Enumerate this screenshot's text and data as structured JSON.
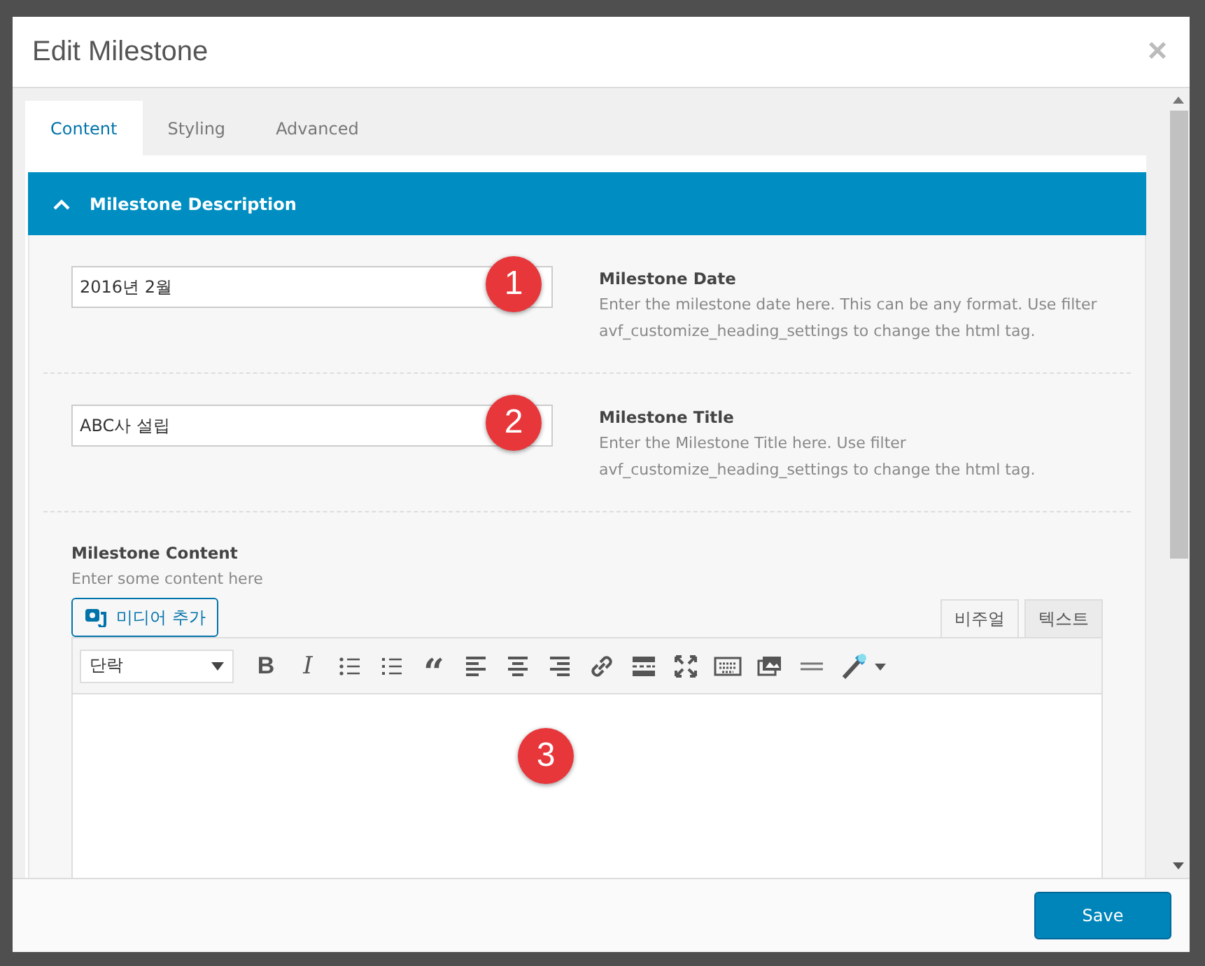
{
  "dialog": {
    "title": "Edit Milestone",
    "close": "×"
  },
  "tabs": [
    {
      "label": "Content",
      "selected": true
    },
    {
      "label": "Styling",
      "selected": false
    },
    {
      "label": "Advanced",
      "selected": false
    }
  ],
  "section": {
    "title": "Milestone Description",
    "expanded": true
  },
  "fields": [
    {
      "value": "2016년 2월",
      "label": "Milestone Date",
      "help": "Enter the milestone date here. This can be any format. Use filter avf_customize_heading_settings to change the html tag.",
      "badge": "1"
    },
    {
      "value": "ABC사 설립",
      "label": "Milestone Title",
      "help": "Enter the Milestone Title here. Use filter avf_customize_heading_settings to change the html tag.",
      "badge": "2"
    }
  ],
  "content_field": {
    "label": "Milestone Content",
    "help": "Enter some content here",
    "media_button": "미디어 추가",
    "editor_tabs": [
      {
        "label": "비주얼",
        "selected": true
      },
      {
        "label": "텍스트",
        "selected": false
      }
    ],
    "format_select": "단락",
    "toolbar": [
      {
        "kind": "glyph",
        "label": "B"
      },
      {
        "kind": "glyph",
        "label": "I"
      },
      {
        "kind": "icon"
      },
      {
        "kind": "icon"
      },
      {
        "kind": "glyph",
        "label": "“"
      },
      {
        "kind": "icon"
      },
      {
        "kind": "icon"
      },
      {
        "kind": "icon"
      },
      {
        "kind": "icon"
      },
      {
        "kind": "icon"
      },
      {
        "kind": "icon"
      },
      {
        "kind": "icon"
      },
      {
        "kind": "icon"
      },
      {
        "kind": "icon"
      },
      {
        "kind": "icon"
      }
    ],
    "badge": "3"
  },
  "footer": {
    "save_button": "Save"
  }
}
